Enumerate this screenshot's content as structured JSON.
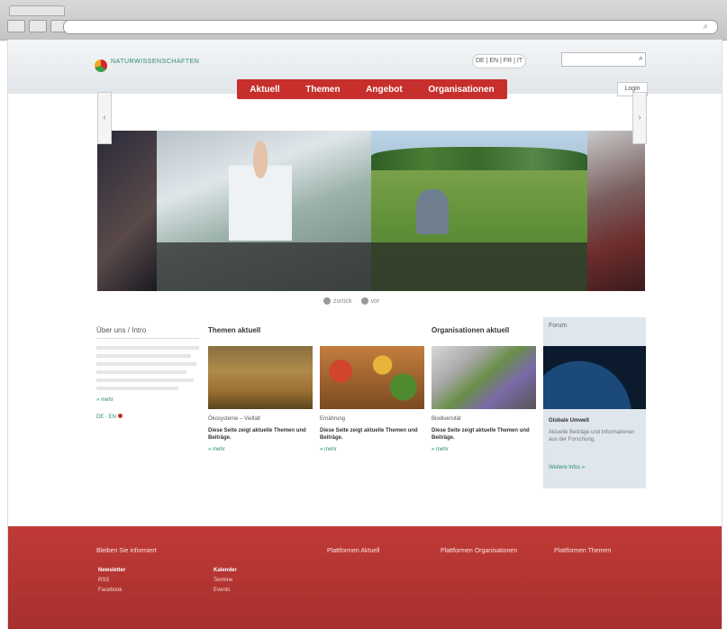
{
  "browser": {
    "url": ""
  },
  "header": {
    "logo_text": "NATURWISSENSCHAFTEN",
    "logo_sub": "",
    "lang_switch": "DE | EN | FR | IT",
    "search_placeholder": "",
    "login_label": "Login"
  },
  "nav": {
    "items": [
      "Aktuell",
      "Themen",
      "Angebot",
      "Organisationen"
    ]
  },
  "carousel": {
    "controls": [
      "zurück",
      "vor"
    ]
  },
  "intro": {
    "title": "Über uns / Intro",
    "link": "» mehr",
    "badge": "DE · EN"
  },
  "sections": {
    "themen_title": "Themen aktuell",
    "orgs_title": "Organisationen aktuell"
  },
  "cards": [
    {
      "topic": "Ökosysteme – Vielfalt",
      "teaser": "Diese Seite zeigt aktuelle Themen und Beiträge.",
      "link": "» mehr"
    },
    {
      "topic": "Ernährung",
      "teaser": "Diese Seite zeigt aktuelle Themen und Beiträge.",
      "link": "» mehr"
    },
    {
      "topic": "Biodiversität",
      "teaser": "Diese Seite zeigt aktuelle Themen und Beiträge.",
      "link": "» mehr"
    }
  ],
  "right_box": {
    "title": "Forum",
    "head": "Globale Umwelt",
    "text": "Aktuelle Beiträge und Informationen aus der Forschung.",
    "link": "Weitere Infos »"
  },
  "footer": {
    "col1_title": "Bleiben Sie informiert",
    "col2_title": "Plattformen Aktuell",
    "col3_title": "Plattformen Organisationen",
    "col4_title": "Plattformen Themen",
    "col1_list": [
      "Newsletter",
      "RSS",
      "Facebook"
    ],
    "col1b_list": [
      "Kalender",
      "Termine",
      "Events"
    ]
  }
}
